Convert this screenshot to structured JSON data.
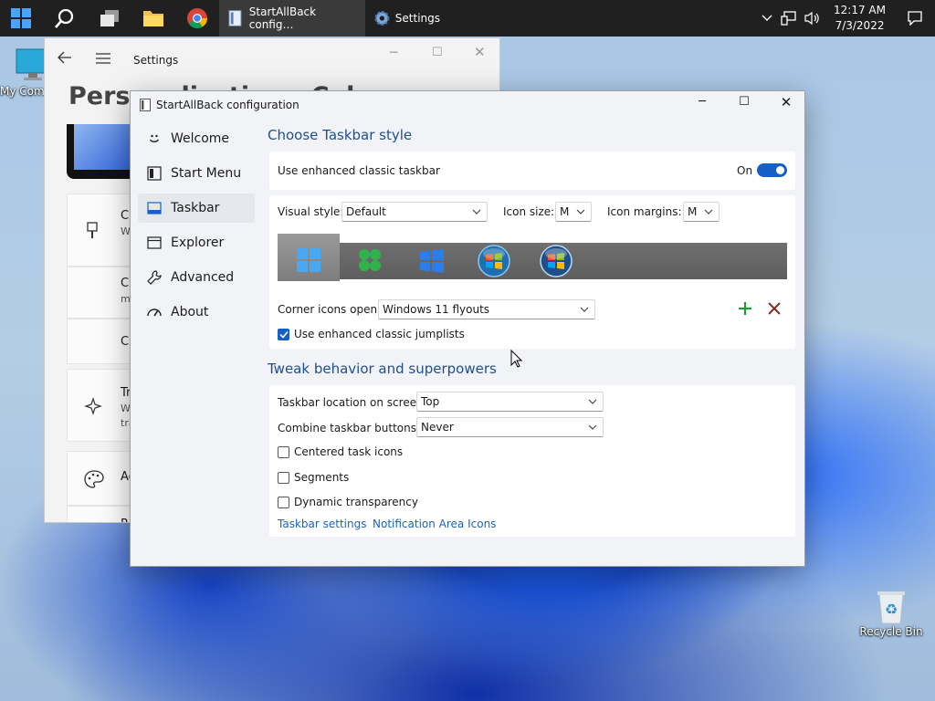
{
  "taskbar": {
    "apps": [
      {
        "label": "StartAllBack config…",
        "active": true
      },
      {
        "label": "Settings",
        "active": false
      }
    ],
    "clock": {
      "time": "12:17 AM",
      "date": "7/3/2022"
    }
  },
  "desktop": {
    "my_computer": "My Com",
    "recycle_bin": "Recycle Bin"
  },
  "settings": {
    "title": "Settings",
    "heading": "Personalization › Colors",
    "cards": [
      {
        "title": "Cl",
        "sub": "W"
      },
      {
        "title": "Cl",
        "sub": "m"
      },
      {
        "title": "Cl",
        "sub": ""
      },
      {
        "title": "Tr",
        "sub": "W",
        "sub2": "tra"
      },
      {
        "title": "Ac",
        "sub": ""
      },
      {
        "title": "R",
        "sub": ""
      }
    ]
  },
  "sab": {
    "title": "StartAllBack configuration",
    "nav": [
      {
        "label": "Welcome",
        "icon": "smile-icon"
      },
      {
        "label": "Start Menu",
        "icon": "start-menu-icon"
      },
      {
        "label": "Taskbar",
        "icon": "taskbar-icon"
      },
      {
        "label": "Explorer",
        "icon": "explorer-icon"
      },
      {
        "label": "Advanced",
        "icon": "wrench-icon"
      },
      {
        "label": "About",
        "icon": "gauge-icon"
      }
    ],
    "selected_nav": "Taskbar",
    "section1": {
      "title": "Choose Taskbar style",
      "enhanced_taskbar_label": "Use enhanced classic taskbar",
      "toggle_state": "On",
      "toggle_on": true,
      "visual_style_label": "Visual style:",
      "visual_style_value": "Default",
      "icon_size_label": "Icon size:",
      "icon_size_value": "M",
      "icon_margins_label": "Icon margins:",
      "icon_margins_value": "M",
      "style_previews": [
        "windows11-logo",
        "clover-logo",
        "windows10-logo",
        "windows7-orb",
        "windows-vista-orb"
      ],
      "selected_preview": 0,
      "corner_icons_label": "Corner icons open:",
      "corner_icons_value": "Windows 11 flyouts",
      "jumplists_label": "Use enhanced classic jumplists",
      "jumplists_checked": true
    },
    "section2": {
      "title": "Tweak behavior and superpowers",
      "location_label": "Taskbar location on screen:",
      "location_value": "Top",
      "combine_label": "Combine taskbar buttons:",
      "combine_value": "Never",
      "centered_label": "Centered task icons",
      "centered_checked": false,
      "segments_label": "Segments",
      "segments_checked": false,
      "dynamic_label": "Dynamic transparency",
      "dynamic_checked": false,
      "link_taskbar_settings": "Taskbar settings",
      "link_notification_icons": "Notification Area Icons"
    }
  },
  "colors": {
    "accent": "#1560c8",
    "title_blue": "#1f4f8f",
    "link": "#1a62c4",
    "add_green": "#1e9a3c",
    "remove_red": "#8a2a2a"
  }
}
